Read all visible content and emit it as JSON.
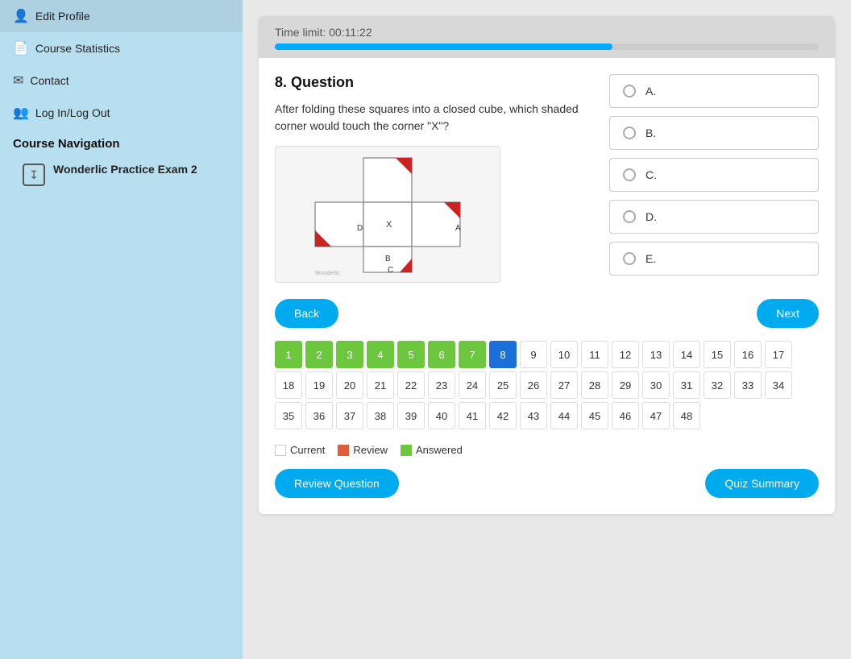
{
  "sidebar": {
    "items": [
      {
        "id": "edit-profile",
        "label": "Edit Profile",
        "icon": "👤"
      },
      {
        "id": "course-statistics",
        "label": "Course Statistics",
        "icon": "📄"
      },
      {
        "id": "contact",
        "label": "Contact",
        "icon": "✉"
      },
      {
        "id": "login-logout",
        "label": "Log In/Log Out",
        "icon": "👥"
      }
    ],
    "section_title": "Course Navigation",
    "course_item": {
      "icon": "↧",
      "label": "Wonderlic Practice Exam 2"
    }
  },
  "timer": {
    "label": "Time limit: 00:11:22",
    "progress_percent": 62
  },
  "question": {
    "number": "8. Question",
    "text": "After folding these squares into a closed cube, which shaded corner would touch the corner \"X\"?"
  },
  "answers": [
    {
      "id": "A",
      "label": "A."
    },
    {
      "id": "B",
      "label": "B."
    },
    {
      "id": "C",
      "label": "C."
    },
    {
      "id": "D",
      "label": "D."
    },
    {
      "id": "E",
      "label": "E."
    }
  ],
  "buttons": {
    "back": "Back",
    "next": "Next",
    "review_question": "Review Question",
    "quiz_summary": "Quiz Summary"
  },
  "number_grid": {
    "total": 48,
    "answered": [
      1,
      2,
      3,
      4,
      5,
      6,
      7
    ],
    "current": [
      8
    ],
    "review": []
  },
  "legend": {
    "current_label": "Current",
    "review_label": "Review",
    "answered_label": "Answered"
  }
}
